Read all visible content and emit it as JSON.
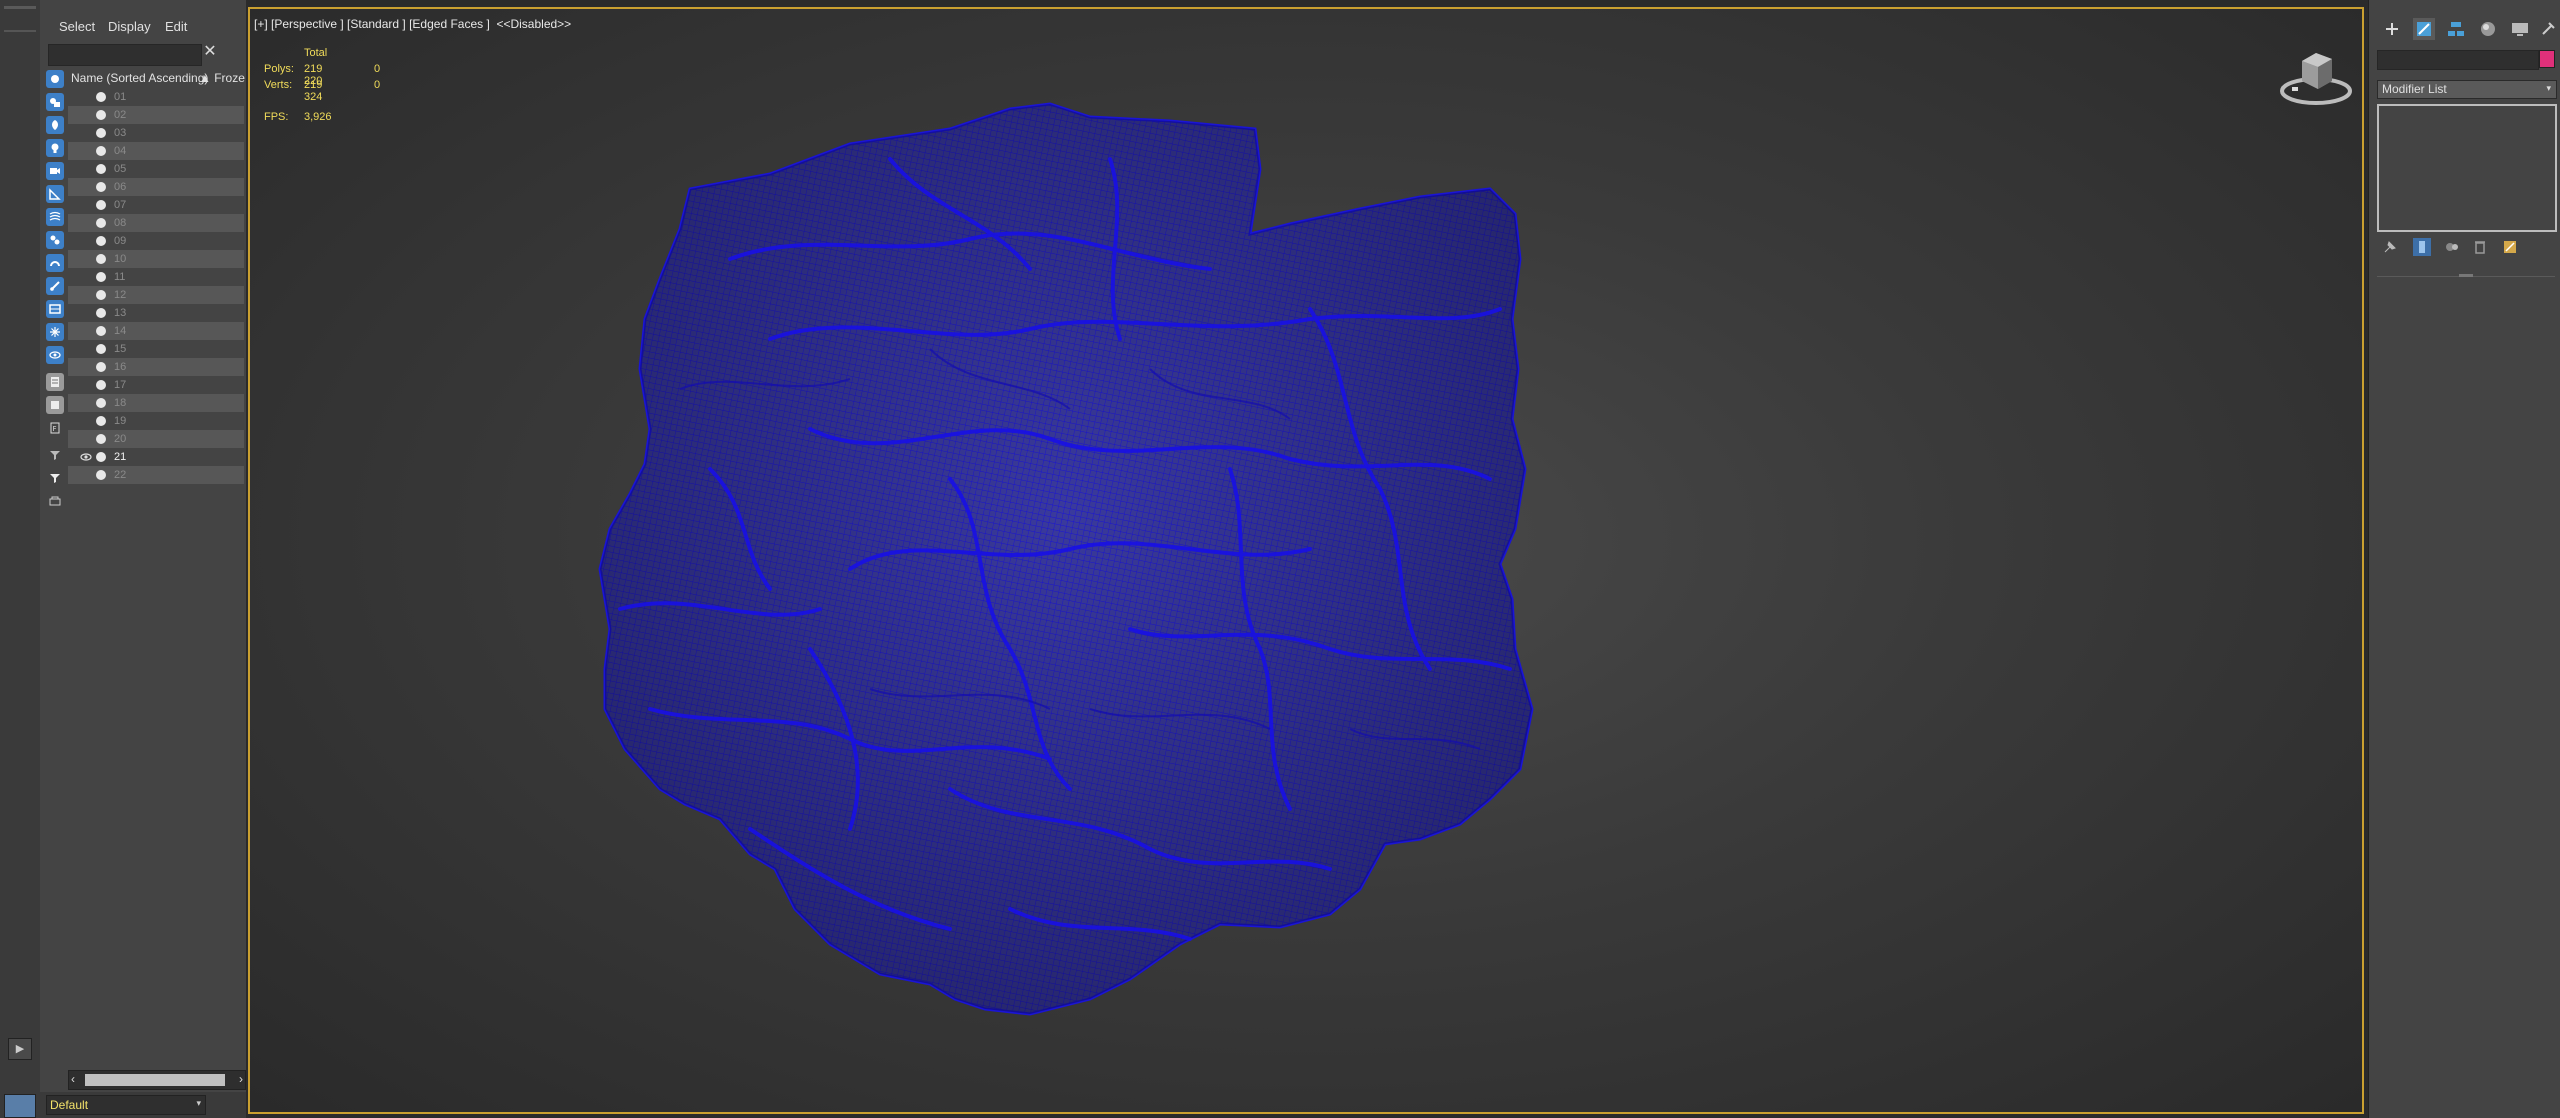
{
  "menu": {
    "select": "Select",
    "display": "Display",
    "edit": "Edit"
  },
  "explorer": {
    "search_value": "",
    "header_name": "Name (Sorted Ascending)",
    "header_froze": "▲ Froze",
    "rows": [
      {
        "label": "01",
        "visible": false
      },
      {
        "label": "02",
        "visible": false
      },
      {
        "label": "03",
        "visible": false
      },
      {
        "label": "04",
        "visible": false
      },
      {
        "label": "05",
        "visible": false
      },
      {
        "label": "06",
        "visible": false
      },
      {
        "label": "07",
        "visible": false
      },
      {
        "label": "08",
        "visible": false
      },
      {
        "label": "09",
        "visible": false
      },
      {
        "label": "10",
        "visible": false
      },
      {
        "label": "11",
        "visible": false
      },
      {
        "label": "12",
        "visible": false
      },
      {
        "label": "13",
        "visible": false
      },
      {
        "label": "14",
        "visible": false
      },
      {
        "label": "15",
        "visible": false
      },
      {
        "label": "16",
        "visible": false
      },
      {
        "label": "17",
        "visible": false
      },
      {
        "label": "18",
        "visible": false
      },
      {
        "label": "19",
        "visible": false
      },
      {
        "label": "20",
        "visible": false
      },
      {
        "label": "21",
        "visible": true
      },
      {
        "label": "22",
        "visible": false
      }
    ],
    "layer": "Default"
  },
  "viewport": {
    "label": "[+] [Perspective ] [Standard ] [Edged Faces ]  <<Disabled>>",
    "stats": {
      "total_header": "Total",
      "polys_label": "Polys:",
      "polys_total": "219 220",
      "polys_sel": "0",
      "verts_label": "Verts:",
      "verts_total": "219 324",
      "verts_sel": "0",
      "fps_label": "FPS:",
      "fps_value": "3,926"
    },
    "mesh_color": "#1a14d6",
    "selection_border_color": "#caa030"
  },
  "command_panel": {
    "object_name": "",
    "object_color": "#e0307a",
    "modifier_list": "Modifier List"
  }
}
